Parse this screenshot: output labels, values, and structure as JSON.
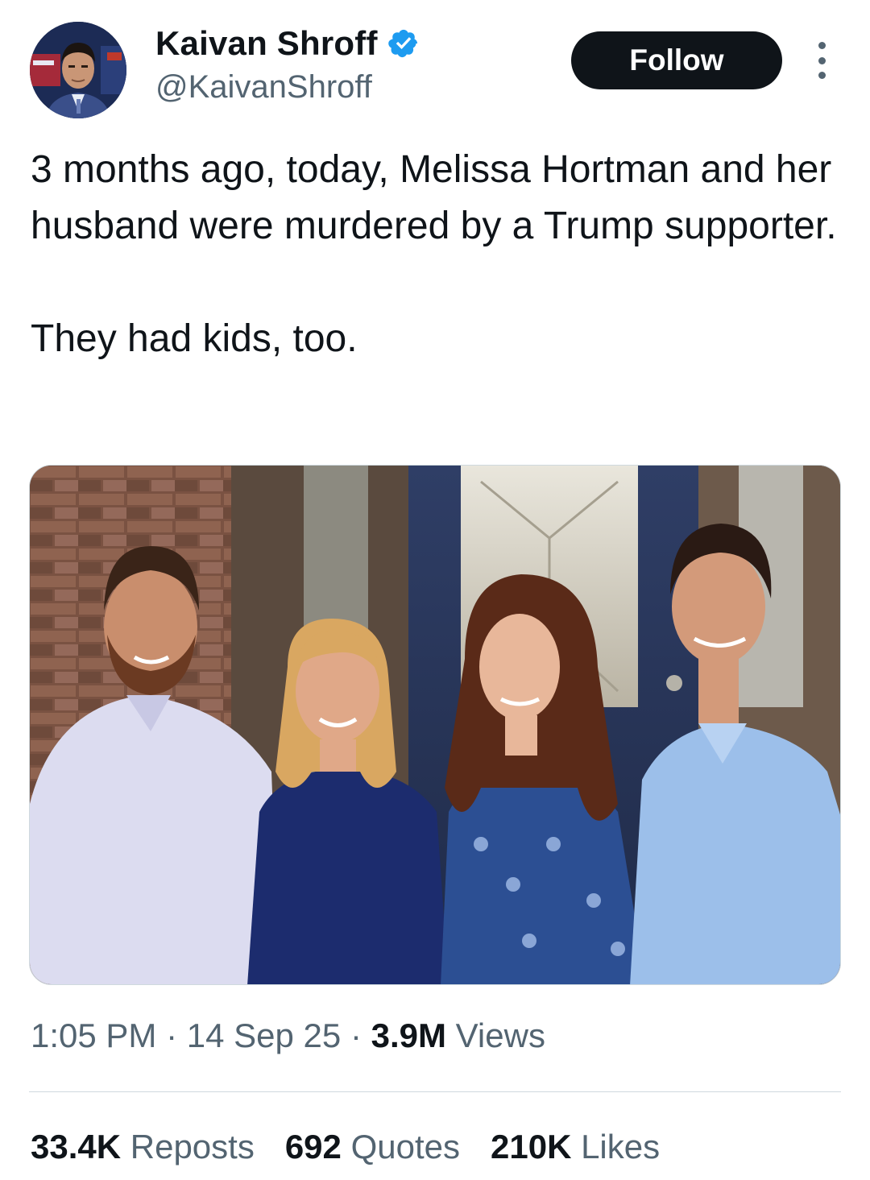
{
  "author": {
    "display_name": "Kaivan Shroff",
    "handle": "@KaivanShroff",
    "verified": true,
    "verified_icon": "verified-badge-icon",
    "avatar_icon": "avatar-photo"
  },
  "actions": {
    "follow_label": "Follow",
    "more_icon": "more-options-icon"
  },
  "tweet": {
    "lines": [
      "3 months ago, today, Melissa Hortman and her husband were murdered by a Trump supporter.",
      "They had kids, too."
    ]
  },
  "media": {
    "type": "photo",
    "description_icon": "family-photo"
  },
  "meta": {
    "time": "1:05 PM",
    "separator": "·",
    "date": "14 Sep 25",
    "views_count": "3.9M",
    "views_label": "Views"
  },
  "stats": {
    "reposts_count": "33.4K",
    "reposts_label": "Reposts",
    "quotes_count": "692",
    "quotes_label": "Quotes",
    "likes_count": "210K",
    "likes_label": "Likes"
  },
  "colors": {
    "text_primary": "#0f1419",
    "text_secondary": "#536471",
    "verified_blue": "#1d9bf0",
    "divider": "#cfd9de",
    "button_bg": "#0f1419"
  }
}
